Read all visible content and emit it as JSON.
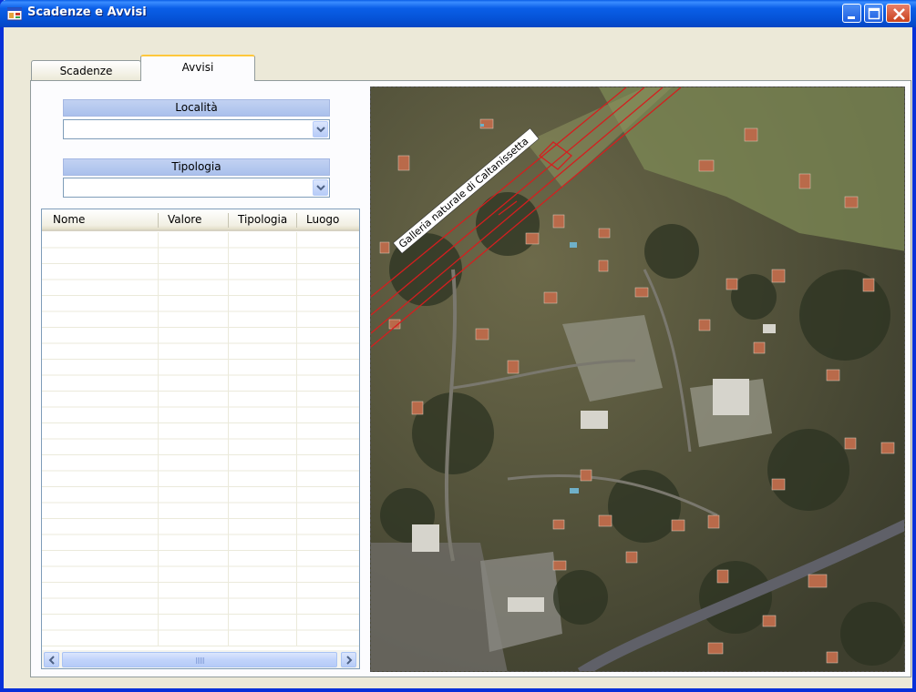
{
  "window": {
    "title": "Scadenze e Avvisi",
    "icon": "app-icon",
    "controls": [
      "minimize-icon",
      "maximize-icon",
      "close-icon"
    ]
  },
  "tabs": [
    {
      "label": "Scadenze",
      "selected": false
    },
    {
      "label": "Avvisi",
      "selected": true
    }
  ],
  "localita": {
    "label": "Località",
    "value": ""
  },
  "tipologia": {
    "label": "Tipologia",
    "value": ""
  },
  "list": {
    "columns": [
      "Nome",
      "Valore",
      "Tipologia",
      "Luogo"
    ],
    "rows": []
  },
  "map": {
    "label": "Galleria naturale di Caltanissetta"
  },
  "colors": {
    "titlebar": "#0a5fe8",
    "tab_accent": "#ffc83c",
    "header_blue": "#aac0ec",
    "window_bg": "#ece9d8"
  }
}
